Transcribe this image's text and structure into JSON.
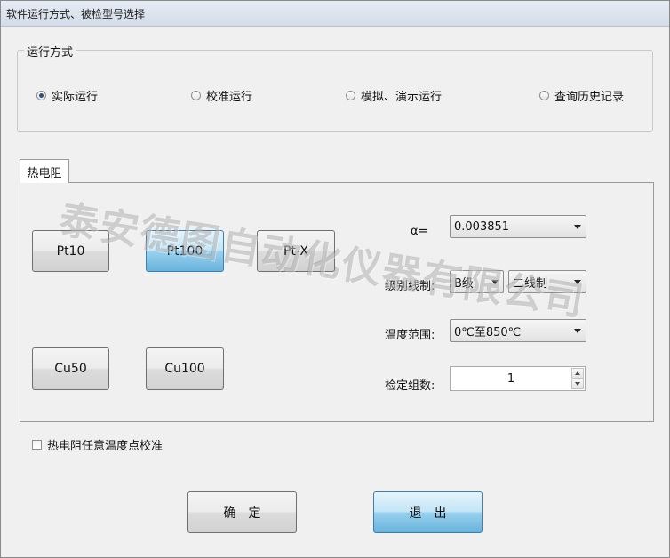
{
  "window": {
    "title": "软件运行方式、被检型号选择"
  },
  "run_mode": {
    "title": "运行方式",
    "options": [
      {
        "label": "实际运行",
        "checked": true
      },
      {
        "label": "校准运行",
        "checked": false
      },
      {
        "label": "模拟、演示运行",
        "checked": false
      },
      {
        "label": "查询历史记录",
        "checked": false
      }
    ]
  },
  "tab": {
    "label": "热电阻"
  },
  "sensor_buttons": {
    "pt10": "Pt10",
    "pt100": "Pt100",
    "ptx": "Pt-X",
    "cu50": "Cu50",
    "cu100": "Cu100",
    "selected": "Pt100"
  },
  "settings": {
    "alpha_label": "α=",
    "alpha_value": "0.003851",
    "grade_label": "级别线制:",
    "grade_value": "B级",
    "wire_value": "二线制",
    "range_label": "温度范围:",
    "range_value": "0℃至850℃",
    "groups_label": "检定组数:",
    "groups_value": "1"
  },
  "arbitrary_calibration": {
    "label": "热电阻任意温度点校准",
    "checked": false
  },
  "buttons": {
    "ok": "确　定",
    "exit": "退　出"
  },
  "watermark": "泰安德图自动化仪器有限公司"
}
